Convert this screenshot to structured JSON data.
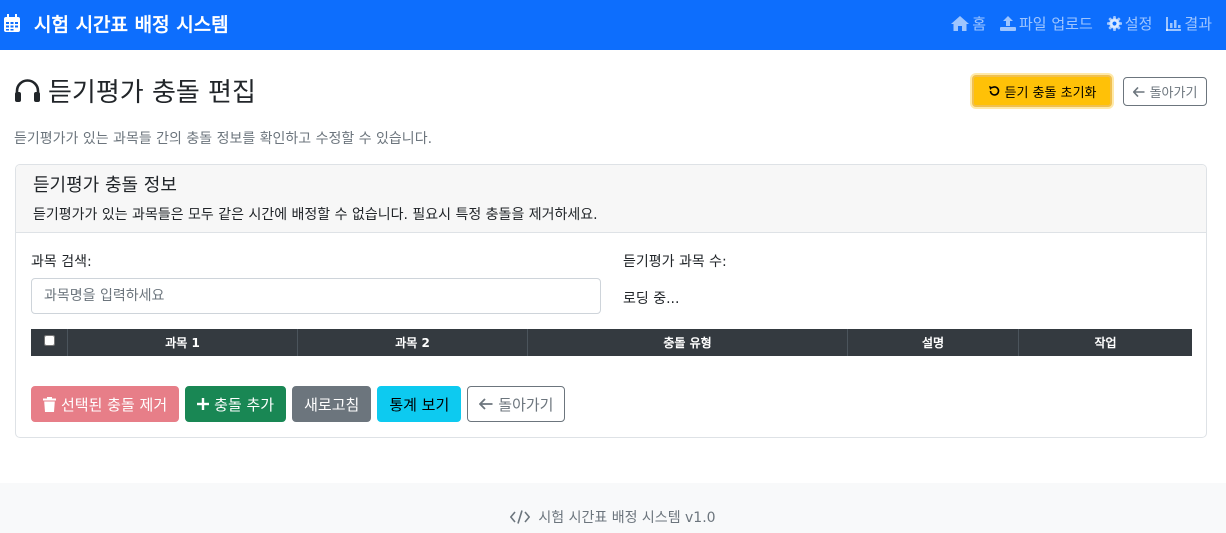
{
  "navbar": {
    "brand": "시험 시간표 배정 시스템",
    "brand_icon": "calendar-icon",
    "items": [
      {
        "label": "홈",
        "icon": "home-icon"
      },
      {
        "label": "파일 업로드",
        "icon": "upload-icon"
      },
      {
        "label": "설정",
        "icon": "gear-icon"
      },
      {
        "label": "결과",
        "icon": "chart-icon"
      }
    ]
  },
  "header": {
    "title": "듣기평가 충돌 편집",
    "title_icon": "headphones-icon",
    "reset_button": "듣기 충돌 초기화",
    "back_button": "돌아가기",
    "subtitle": "듣기평가가 있는 과목들 간의 충돌 정보를 확인하고 수정할 수 있습니다."
  },
  "card": {
    "title": "듣기평가 충돌 정보",
    "description": "듣기평가가 있는 과목들은 모두 같은 시간에 배정할 수 없습니다. 필요시 특정 충돌을 제거하세요.",
    "search_label": "과목 검색:",
    "search_placeholder": "과목명을 입력하세요",
    "search_value": "",
    "count_label": "듣기평가 과목 수:",
    "count_value": "로딩 중...",
    "table_headers": [
      "과목 1",
      "과목 2",
      "충돌 유형",
      "설명",
      "작업"
    ],
    "buttons": {
      "remove_selected": "선택된 충돌 제거",
      "add_conflict": "충돌 추가",
      "refresh": "새로고침",
      "stats": "통계 보기",
      "back": "돌아가기"
    }
  },
  "footer": {
    "text": "시험 시간표 배정 시스템 v1.0",
    "icon": "code-icon"
  },
  "colors": {
    "primary": "#0d6efd",
    "warning": "#ffc107",
    "danger_disabled": "#e77e88",
    "success": "#198754",
    "secondary": "#6c757d",
    "info": "#0dcaf0",
    "table_header": "#343a40"
  }
}
